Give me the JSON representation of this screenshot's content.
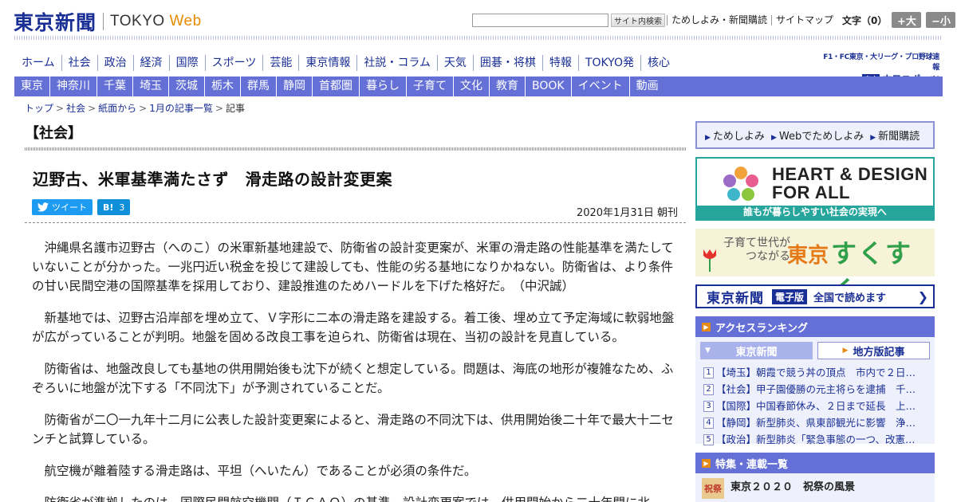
{
  "header": {
    "logo_jp": "東京新聞",
    "logo_en_a": "TOKYO",
    "logo_en_b": "Web",
    "search_placeholder": "",
    "search_button": "サイト内検索",
    "links": [
      "ためしよみ・新聞購読",
      "サイトマップ"
    ],
    "font_size_label": "文字（0）",
    "font_up": "+大",
    "font_down": "−小"
  },
  "main_nav": [
    "ホーム",
    "社会",
    "政治",
    "経済",
    "国際",
    "スポーツ",
    "芸能",
    "東京情報",
    "社説・コラム",
    "天気",
    "囲碁・将棋",
    "特報",
    "TOKYO発",
    "核心"
  ],
  "chunichi": {
    "line1": "F1・FC東京・大リーグ・プロ野球速報",
    "badge": "東京",
    "line2": "中日スポーツ"
  },
  "region_nav": [
    "東京",
    "神奈川",
    "千葉",
    "埼玉",
    "茨城",
    "栃木",
    "群馬",
    "静岡",
    "首都圏",
    "暮らし",
    "子育て",
    "文化",
    "教育",
    "BOOK",
    "イベント",
    "動画"
  ],
  "breadcrumb": [
    "トップ",
    "社会",
    "紙面から",
    "1月の記事一覧",
    "記事"
  ],
  "article": {
    "section": "【社会】",
    "title": "辺野古、米軍基準満たさず　滑走路の設計変更案",
    "tweet_label": "ツイート",
    "hatena_label": "B!",
    "hatena_count": "3",
    "date": "2020年1月31日 朝刊",
    "paragraphs": [
      "沖縄県名護市辺野古（へのこ）の米軍新基地建設で、防衛省の設計変更案が、米軍の滑走路の性能基準を満たしていないことが分かった。一兆円近い税金を投じて建設しても、性能の劣る基地になりかねない。防衛省は、より条件の甘い民間空港の国際基準を採用しており、建設推進のためハードルを下げた格好だ。　（中沢誠）",
      "新基地では、辺野古沿岸部を埋め立て、Ｖ字形に二本の滑走路を建設する。着工後、埋め立て予定海域に軟弱地盤が広がっていることが判明。地盤を固める改良工事を迫られ、防衛省は現在、当初の設計を見直している。",
      "防衛省は、地盤改良しても基地の供用開始後も沈下が続くと想定している。問題は、海底の地形が複雑なため、ふぞろいに地盤が沈下する「不同沈下」が予測されていることだ。",
      "防衛省が二〇一九年十二月に公表した設計変更案によると、滑走路の不同沈下は、供用開始後二十年で最大十二センチと試算している。",
      "航空機が離着陸する滑走路は、平坦（へいたん）であることが必須の条件だ。",
      "防衛省が準拠したのは、国際民間航空機関（ＩＣＡＯ）の基準。設計変更案では、供用開始から二十年間に北"
    ]
  },
  "sidebar": {
    "tameshi": [
      "ためしよみ",
      "Webでためしよみ",
      "新聞購読"
    ],
    "heart_line1": "HEART & DESIGN",
    "heart_line2": "FOR ALL",
    "heart_caption": "誰もが暮らしやすい社会の実現へ",
    "sukusuku_small": "子育て世代が\nつながる",
    "sukusuku_tokyo": "東京",
    "sukusuku_big": "すくすく",
    "denshi_logo": "東京新聞",
    "denshi_badge": "電子版",
    "denshi_text": "全国で読めます",
    "ranking_title": "アクセスランキング",
    "ranking_tabs": [
      "東京新聞",
      "地方版記事"
    ],
    "ranking": [
      {
        "n": "1",
        "text": "【埼玉】朝霞で競う丼の頂点　市内で２日…"
      },
      {
        "n": "2",
        "text": "【社会】甲子園優勝の元主将らを逮捕　千…"
      },
      {
        "n": "3",
        "text": "【国際】中国春節休み、２日まで延長　上…"
      },
      {
        "n": "4",
        "text": "【静岡】新型肺炎、県東部観光に影響　浄…"
      },
      {
        "n": "5",
        "text": "【政治】新型肺炎「緊急事態の一つ、改憲…"
      }
    ],
    "toku_title": "特集・連載一覧",
    "toku_thumb": "祝祭",
    "toku_item": "東京２０２０　祝祭の風景"
  },
  "colors": {
    "brand": "#1a2f95",
    "nav_bar": "#6470d6",
    "accent": "#e68a00",
    "heart": "#25a59b"
  }
}
